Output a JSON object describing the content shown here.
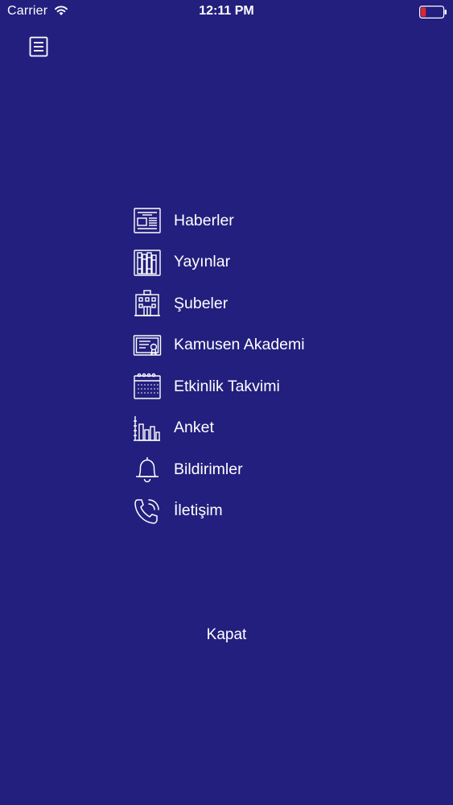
{
  "status_bar": {
    "carrier": "Carrier",
    "time": "12:11 PM",
    "battery_color": "#e0262f"
  },
  "header": {
    "menu_icon": "list-icon"
  },
  "menu": {
    "items": [
      {
        "label": "Haberler",
        "icon": "newspaper-icon"
      },
      {
        "label": "Yayınlar",
        "icon": "books-icon"
      },
      {
        "label": "Şubeler",
        "icon": "building-icon"
      },
      {
        "label": "Kamusen Akademi",
        "icon": "certificate-icon"
      },
      {
        "label": "Etkinlik Takvimi",
        "icon": "calendar-icon"
      },
      {
        "label": "Anket",
        "icon": "bar-chart-icon"
      },
      {
        "label": "Bildirimler",
        "icon": "bell-icon"
      },
      {
        "label": "İletişim",
        "icon": "phone-icon"
      }
    ]
  },
  "footer": {
    "close_label": "Kapat"
  },
  "colors": {
    "background": "#231f7e",
    "foreground": "#ffffff"
  }
}
